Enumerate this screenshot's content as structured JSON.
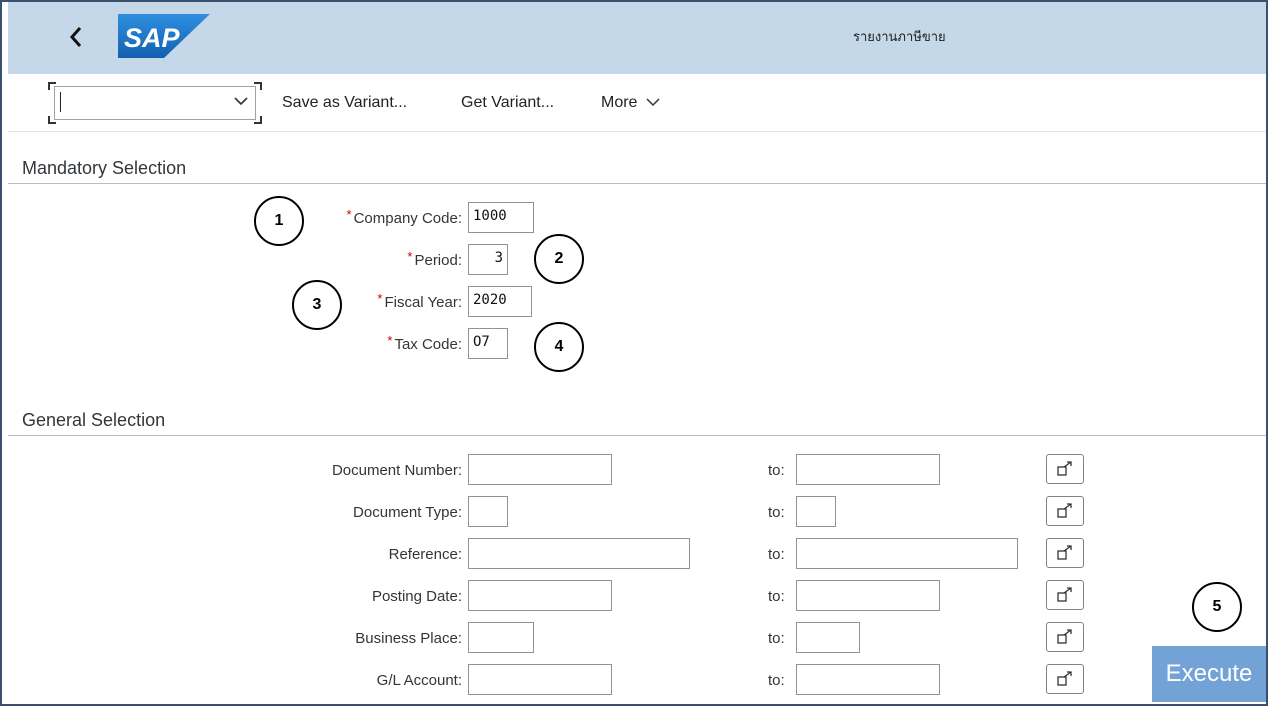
{
  "header": {
    "title": "รายงานภาษีขาย",
    "logo_text": "SAP"
  },
  "toolbar": {
    "variant_value": "",
    "save_variant": "Save as Variant...",
    "get_variant": "Get Variant...",
    "more": "More"
  },
  "mandatory": {
    "heading": "Mandatory Selection",
    "fields": [
      {
        "label": "Company Code:",
        "value": "1000",
        "required": "*",
        "callout": "1"
      },
      {
        "label": "Period:",
        "value": "3",
        "required": "*",
        "callout": "2"
      },
      {
        "label": "Fiscal Year:",
        "value": "2020",
        "required": "*",
        "callout": "3"
      },
      {
        "label": "Tax Code:",
        "value": "O7",
        "required": "*",
        "callout": "4"
      }
    ]
  },
  "general": {
    "heading": "General Selection",
    "to_label": "to:",
    "fields": [
      {
        "label": "Document Number:",
        "from": "",
        "to": ""
      },
      {
        "label": "Document Type:",
        "from": "",
        "to": ""
      },
      {
        "label": "Reference:",
        "from": "",
        "to": ""
      },
      {
        "label": "Posting Date:",
        "from": "",
        "to": ""
      },
      {
        "label": "Business Place:",
        "from": "",
        "to": ""
      },
      {
        "label": "G/L Account:",
        "from": "",
        "to": ""
      }
    ]
  },
  "footer": {
    "execute": "Execute",
    "callout": "5"
  },
  "colors": {
    "header_bg": "#c5d8e9",
    "execute_bg": "#73a3d6",
    "sap_blue": "#1a73c9"
  },
  "icons": {
    "back": "chevron-left-icon",
    "dropdown": "chevron-down-icon",
    "multi": "multiple-selection-icon"
  }
}
